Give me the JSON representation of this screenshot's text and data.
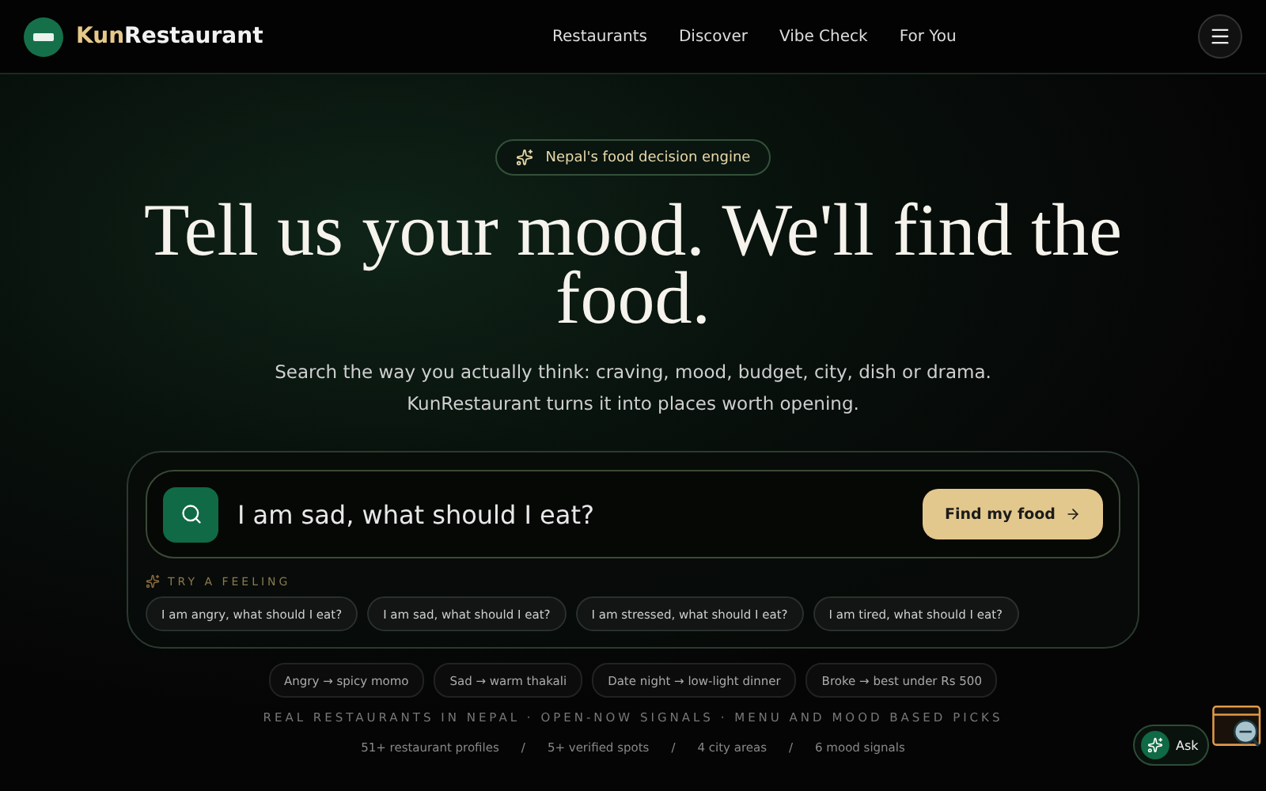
{
  "header": {
    "brand": {
      "accent": "Kun",
      "rest": "Restaurant"
    },
    "nav": [
      {
        "label": "Restaurants"
      },
      {
        "label": "Discover"
      },
      {
        "label": "Vibe Check"
      },
      {
        "label": "For You"
      }
    ]
  },
  "hero": {
    "badge": "Nepal's food decision engine",
    "title": "Tell us your mood. We'll find the food.",
    "subtitle": [
      "Search the way you actually think: craving, mood, budget, city, dish or drama.",
      "KunRestaurant turns it into places worth opening."
    ]
  },
  "search": {
    "value": "I am sad, what should I eat?",
    "button": "Find my food",
    "try_label": "TRY A FEELING",
    "feelings": [
      "I am angry, what should I eat?",
      "I am sad, what should I eat?",
      "I am stressed, what should I eat?",
      "I am tired, what should I eat?"
    ]
  },
  "examples": [
    "Angry → spicy momo",
    "Sad → warm thakali",
    "Date night → low-light dinner",
    "Broke → best under Rs 500"
  ],
  "tagline": "REAL RESTAURANTS IN NEPAL · OPEN-NOW SIGNALS · MENU AND MOOD BASED PICKS",
  "stats": [
    "51+ restaurant profiles",
    "5+ verified spots",
    "4 city areas",
    "6 mood signals"
  ],
  "stat_separator": "/",
  "ask_button": "Ask"
}
